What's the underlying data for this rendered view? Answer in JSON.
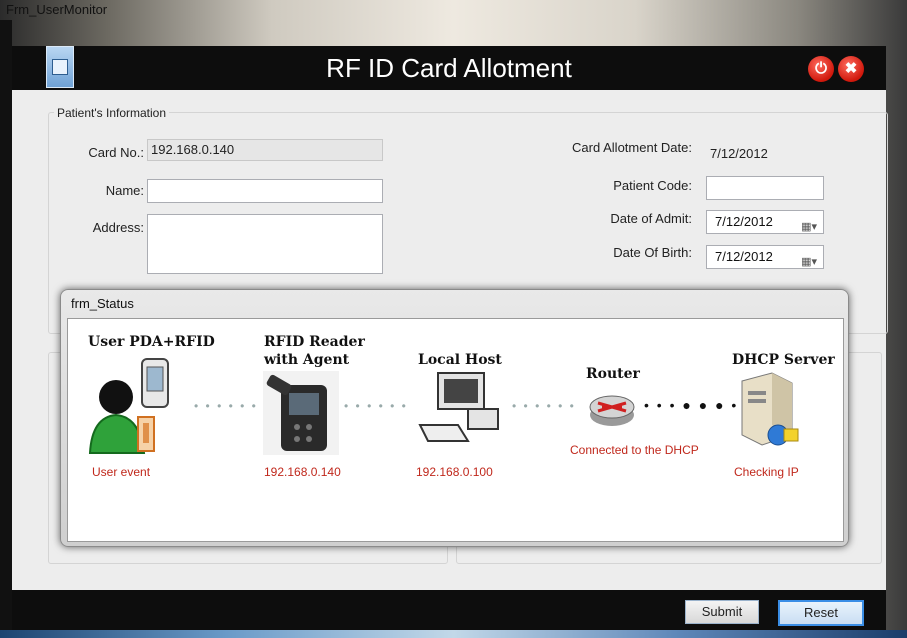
{
  "window": {
    "title": "Frm_UserMonitor"
  },
  "header": {
    "title": "RF ID Card Allotment",
    "power_icon": "power-icon",
    "close_icon": "close-icon",
    "power_glyph": "⏻",
    "close_glyph": "✖"
  },
  "patient_info": {
    "group_label": "Patient's Information",
    "card_no_label": "Card No.:",
    "card_no_value": "192.168.0.140",
    "name_label": "Name:",
    "name_value": "",
    "address_label": "Address:",
    "address_value": "",
    "card_allot_date_label": "Card Allotment Date:",
    "card_allot_date_value": "7/12/2012",
    "patient_code_label": "Patient Code:",
    "patient_code_value": "",
    "date_admit_label": "Date of Admit:",
    "date_admit_value": "7/12/2012",
    "dob_label": "Date Of Birth:",
    "dob_value": "7/12/2012"
  },
  "footer": {
    "submit_label": "Submit",
    "reset_label": "Reset"
  },
  "status_dialog": {
    "title": "frm_Status",
    "nodes": [
      {
        "title": "User PDA+RFID",
        "sub": "User event",
        "icon": "user-pda-icon"
      },
      {
        "title": "RFID Reader",
        "title2": "with Agent",
        "sub": "192.168.0.140",
        "icon": "rfid-reader-icon"
      },
      {
        "title": "Local Host",
        "sub": "192.168.0.100",
        "icon": "computer-icon"
      },
      {
        "title": "Router",
        "sub": "Connected to the DHCP",
        "icon": "router-icon"
      },
      {
        "title": "DHCP Server",
        "sub": "Checking IP",
        "icon": "server-icon"
      }
    ],
    "connector": "• • • • • •",
    "connector_active": "• • • ● ● ● • •"
  },
  "colors": {
    "accent": "#c0281c",
    "titlebar": "#0d0d0d",
    "form_bg": "#ededed"
  }
}
